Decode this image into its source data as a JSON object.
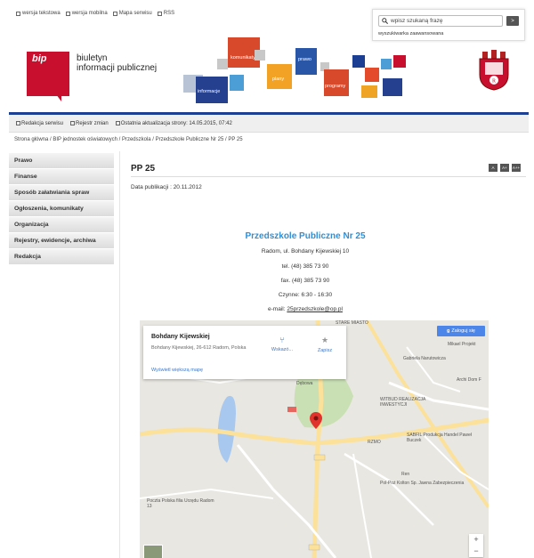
{
  "topnav": {
    "items": [
      "wersja tekstowa",
      "wersja mobilna",
      "Mapa serwisu",
      "RSS"
    ]
  },
  "search": {
    "placeholder": "wpisz szukaną frazę",
    "button_label": ">",
    "advanced_label": "wyszukiwarka zaawansowana"
  },
  "header": {
    "logo_word": "bip",
    "logo_text_line1": "biuletyn",
    "logo_text_line2": "informacji publicznej",
    "tiles": [
      "informacje",
      "komunikaty",
      "plany",
      "prawo",
      "programy"
    ]
  },
  "infobar": {
    "items": [
      "Redakcja serwisu",
      "Rejestr zmian",
      "Ostatnia aktualizacja strony: 14.05.2015, 07:42"
    ]
  },
  "breadcrumb": "Strona główna / BIP jednostek oświatowych / Przedszkola / Przedszkole Publiczne Nr 25 / PP 25",
  "sidebar": {
    "items": [
      "Prawo",
      "Finanse",
      "Sposób załatwiania spraw",
      "Ogłoszenia, komunikaty",
      "Organizacja",
      "Rejestry, ewidencje, archiwa",
      "Redakcja"
    ]
  },
  "main": {
    "title": "PP 25",
    "font_buttons": [
      "A",
      "A+",
      "A++"
    ],
    "pub_date": "Data publikacji : 20.11.2012",
    "school_name": "Przedszkole Publiczne Nr 25",
    "address": "Radom, ul. Bohdany Kijewskiej 10",
    "tel": "tel. (48) 385 73 90",
    "fax": "fax. (48) 385 73 90",
    "hours": "Czynne: 6:30 - 16:30",
    "email_label": "e-mail: ",
    "email": "25przedszkole@op.pl"
  },
  "map": {
    "card_title": "Bohdany Kijewskiej",
    "card_address": "Bohdany Kijewskiej, 26-612 Radom, Polska",
    "directions_label": "Wskazó...",
    "save_label": "Zapisz",
    "larger_map_label": "Wyświetl większą mapę",
    "login_label": "Zaloguj się",
    "labels": {
      "stare_miasto": "STARE MIASTO",
      "gabriela": "Gabriela Narutowicza",
      "mikael": "Mikael Projekt",
      "archi": "Archi Dom F",
      "witbud": "WITBUD REALIZACJA INWESTYCJI",
      "rzmo": "RZMO",
      "sabfil": "SABFIL Produkcja Handel Paweł Buczek",
      "polpoz": "Pol-Poż Kolton Sp. Jawna Zabezpieczenia",
      "poczta": "Poczta Polska filia Urzędu Radom 13",
      "debowa": "Dębowa",
      "ren": "Ren"
    },
    "zoom_in": "+",
    "zoom_out": "−"
  },
  "colors": {
    "accent_blue": "#1c3f94",
    "bip_red": "#c8102e",
    "school_blue": "#2f8fd6"
  }
}
